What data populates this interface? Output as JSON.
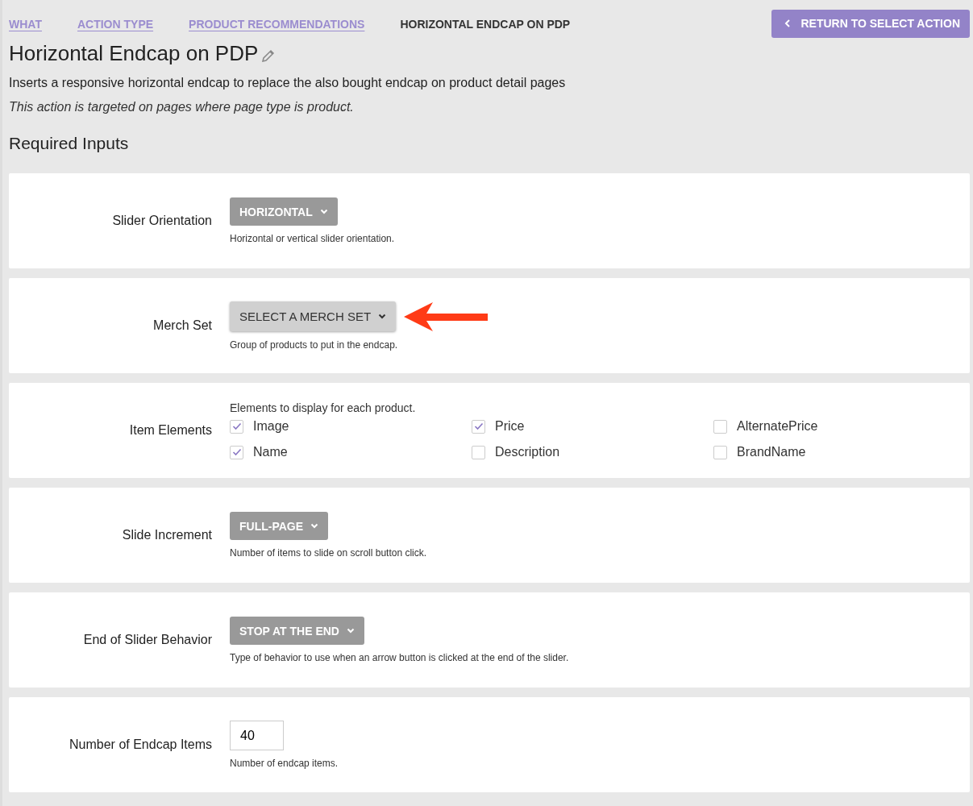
{
  "breadcrumbs": [
    {
      "label": "WHAT",
      "selected": false
    },
    {
      "label": "ACTION TYPE",
      "selected": false
    },
    {
      "label": "PRODUCT RECOMMENDATIONS",
      "selected": false
    },
    {
      "label": "HORIZONTAL ENDCAP ON PDP",
      "selected": true
    }
  ],
  "return_button": {
    "label": "RETURN TO SELECT ACTION"
  },
  "title": "Horizontal Endcap on PDP",
  "description": "Inserts a responsive horizontal endcap to replace the also bought endcap on product detail pages",
  "targeting_note": "This action is targeted on pages where page type is product.",
  "section_title": "Required Inputs",
  "inputs": [
    {
      "kind": "dropdown",
      "label": "Slider Orientation",
      "value": "HORIZONTAL",
      "empty": false,
      "callout_arrow": false,
      "help": "Horizontal or vertical slider orientation."
    },
    {
      "kind": "dropdown",
      "label": "Merch Set",
      "value": "SELECT A MERCH SET",
      "empty": true,
      "callout_arrow": true,
      "help": "Group of products to put in the endcap."
    },
    {
      "kind": "checkboxes",
      "label": "Item Elements",
      "help": "Elements to display for each product.",
      "options": [
        {
          "label": "Image",
          "checked": true
        },
        {
          "label": "Price",
          "checked": true
        },
        {
          "label": "AlternatePrice",
          "checked": false
        },
        {
          "label": "Name",
          "checked": true
        },
        {
          "label": "Description",
          "checked": false
        },
        {
          "label": "BrandName",
          "checked": false
        }
      ]
    },
    {
      "kind": "dropdown",
      "label": "Slide Increment",
      "value": "FULL-PAGE",
      "empty": false,
      "callout_arrow": false,
      "help": "Number of items to slide on scroll button click."
    },
    {
      "kind": "dropdown",
      "label": "End of Slider Behavior",
      "value": "STOP AT THE END",
      "empty": false,
      "callout_arrow": false,
      "help": "Type of behavior to use when an arrow button is clicked at the end of the slider."
    },
    {
      "kind": "number",
      "label": "Number of Endcap Items",
      "value": "40",
      "help": "Number of endcap items."
    }
  ]
}
